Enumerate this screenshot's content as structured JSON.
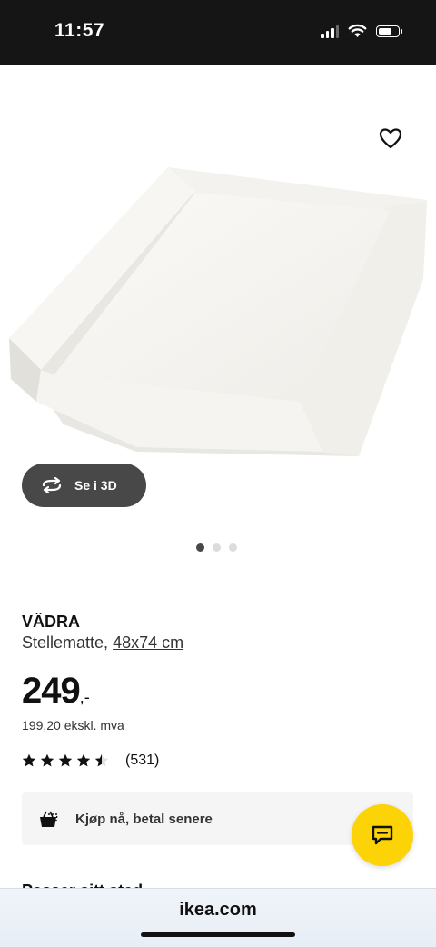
{
  "status_bar": {
    "time": "11:57",
    "battery_level": 0.75
  },
  "gallery": {
    "view_3d_label": "Se i 3D",
    "slide_count": 3,
    "active_slide": 1
  },
  "product": {
    "name": "VÄDRA",
    "description": "Stellematte,",
    "size_link": "48x74 cm",
    "price": "249",
    "price_suffix": ",-",
    "price_excl_vat": "199,20 ekskl. mva",
    "rating_value": 4.5,
    "rating_max": 5,
    "review_count": "(531)"
  },
  "bnpl": {
    "label": "Kjøp nå, betal senere"
  },
  "next_section_partial": "Passer sitt sted",
  "browser": {
    "url": "ikea.com"
  },
  "colors": {
    "chat_button": "#fcd307",
    "dark_button": "#484848"
  }
}
